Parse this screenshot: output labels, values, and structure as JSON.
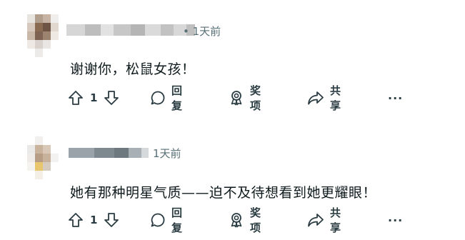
{
  "comments": [
    {
      "time": "• 1天前",
      "text": "谢谢你，松鼠女孩！",
      "score": "1",
      "actions": {
        "reply": "回复",
        "award": "奖项",
        "share": "共享",
        "more": "···"
      }
    },
    {
      "time": "1天前",
      "text": "她有那种明星气质——迫不及待想看到她更耀眼！",
      "score": "1",
      "actions": {
        "reply": "回复",
        "award": "奖项",
        "share": "共享",
        "more": "···"
      }
    }
  ],
  "icons": {
    "upvote": "arrow-up-icon",
    "downvote": "arrow-down-icon",
    "reply": "speech-bubble-icon",
    "award": "award-ribbon-icon",
    "share": "share-arrow-icon",
    "more": "more-horizontal-icon"
  },
  "colors": {
    "text": "#0f1a1c",
    "muted": "#576f76",
    "action": "#2a3c42"
  }
}
